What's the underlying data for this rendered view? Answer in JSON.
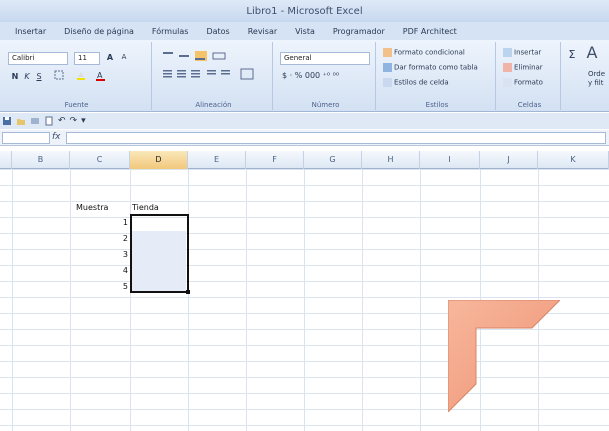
{
  "window": {
    "title": "Libro1 - Microsoft Excel"
  },
  "tabs": [
    "Insertar",
    "Diseño de página",
    "Fórmulas",
    "Datos",
    "Revisar",
    "Vista",
    "Programador",
    "PDF Architect"
  ],
  "ribbon": {
    "font": {
      "name": "Calibri",
      "size": "11",
      "group_label": "Fuente"
    },
    "alignment": {
      "group_label": "Alineación"
    },
    "number": {
      "format": "General",
      "group_label": "Número"
    },
    "styles": {
      "items": [
        "Formato condicional",
        "Dar formato como tabla",
        "Estilos de celda"
      ],
      "group_label": "Estilos"
    },
    "cells": {
      "items": [
        "Insertar",
        "Eliminar",
        "Formato"
      ],
      "group_label": "Celdas"
    },
    "editing": {
      "sort_label": "Orde",
      "filter_label": "y filt"
    }
  },
  "formula_bar": {
    "fx_label": "fx",
    "value": ""
  },
  "columns": [
    "B",
    "C",
    "D",
    "E",
    "F",
    "G",
    "H",
    "I",
    "J",
    "K"
  ],
  "active_column": "D",
  "cells": {
    "C_header": "Muestra",
    "D_header": "Tienda",
    "numbers": [
      "1",
      "2",
      "3",
      "4",
      "5"
    ]
  },
  "colors": {
    "accent_title": "#c7d8ef",
    "selection_border": "#111111",
    "arrow_fill": "#f3a68c"
  }
}
